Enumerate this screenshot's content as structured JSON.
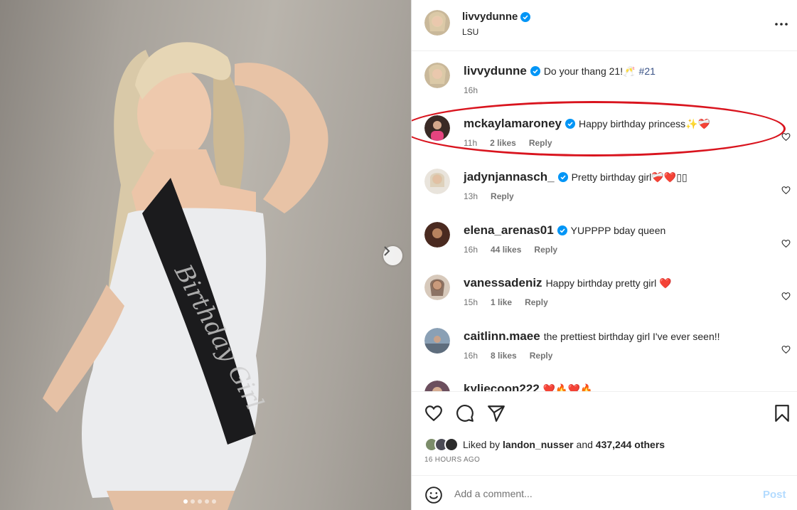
{
  "post": {
    "carousel": {
      "slide_count": 5,
      "active_slide": 1
    },
    "header": {
      "username": "livvydunne",
      "subtitle": "LSU",
      "verified": true
    }
  },
  "caption": {
    "username": "livvydunne",
    "text": "Do your thang 21!🥂",
    "hashtag": "#21",
    "time": "16h"
  },
  "comments": [
    {
      "username": "mckaylamaroney",
      "verified": true,
      "text": "Happy birthday princess✨❤️‍🩹",
      "time": "11h",
      "likes": "2 likes",
      "reply": "Reply"
    },
    {
      "username": "jadynjannasch_",
      "verified": true,
      "text": "Pretty birthday girl❤️‍🩹❤️▯▯",
      "time": "13h",
      "likes": "",
      "reply": "Reply"
    },
    {
      "username": "elena_arenas01",
      "verified": true,
      "text": "YUPPPP bday queen",
      "time": "16h",
      "likes": "44 likes",
      "reply": "Reply"
    },
    {
      "username": "vanessadeniz",
      "verified": false,
      "text": "Happy birthday pretty girl ❤️",
      "time": "15h",
      "likes": "1 like",
      "reply": "Reply"
    },
    {
      "username": "caitlinn.maee",
      "verified": false,
      "text": "the prettiest birthday girl I've ever seen!!",
      "time": "16h",
      "likes": "8 likes",
      "reply": "Reply"
    },
    {
      "username": "kyliecoon222",
      "verified": false,
      "text": "❤️🔥❤️🔥",
      "time": "",
      "likes": "",
      "reply": ""
    }
  ],
  "footer": {
    "liked_by_prefix": "Liked by",
    "liked_by_user": "landon_nusser",
    "liked_by_and": "and",
    "liked_by_count": "437,244 others",
    "time_ago": "16 HOURS AGO"
  },
  "add_comment": {
    "placeholder": "Add a comment...",
    "post_label": "Post"
  },
  "icons": {
    "like": "heart-icon",
    "comment": "comment-icon",
    "share": "share-icon",
    "save": "bookmark-icon",
    "more": "more-options-icon",
    "emoji": "emoji-icon",
    "next": "chevron-right-icon",
    "verified": "verified-badge-icon"
  },
  "colors": {
    "verified": "#0095f6",
    "link": "#385185",
    "post_disabled": "#b3dbff",
    "highlight_oval": "#d9141e"
  }
}
